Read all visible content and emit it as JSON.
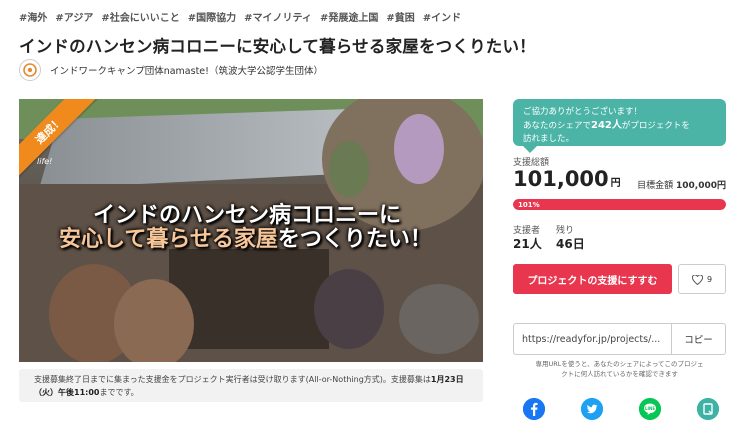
{
  "tags": [
    "#海外",
    "#アジア",
    "#社会にいいこと",
    "#国際協力",
    "#マイノリティ",
    "#発展途上国",
    "#貧困",
    "#インド"
  ],
  "project": {
    "title": "インドのハンセン病コロニーに安心して暮らせる家屋をつくりたい！",
    "org_name": "インドワークキャンプ団体namaste!（筑波大学公認学生団体）"
  },
  "hero": {
    "line1": "インドのハンセン病コロニーに",
    "line2_accent": "安心して暮らせる家屋",
    "line2_rest": "をつくりたい！",
    "ribbon": "達成！",
    "logo_text": "life!"
  },
  "notice": {
    "text_before": "支援募集終了日までに集まった支援金をプロジェクト実行者は受け取ります(All-or-Nothing方式)。支援募集は",
    "deadline": "1月23日（火）午後11:00",
    "text_after": "までです。"
  },
  "panel": {
    "balloon_line1": "ご協力ありがとうございます！",
    "balloon_pre": "あなたのシェアで",
    "balloon_count": "242人",
    "balloon_post": "がプロジェクトを",
    "balloon_line3": "訪れました。",
    "total_label": "支援総額",
    "total_amount": "101,000",
    "total_unit": "円",
    "goal_label": "目標金額",
    "goal_amount": "100,000円",
    "progress_text": "101%",
    "progress_fraction": 1.0,
    "supporters_label": "支援者",
    "supporters_value": "21人",
    "remaining_label": "残り",
    "remaining_value": "46日",
    "support_button": "プロジェクトの支援にすすむ",
    "like_count": "9",
    "share_url": "https://readyfor.jp/projects/...",
    "copy_button": "コピー",
    "share_note_line1": "専用URLを使うと、あなたのシェアによってこのプロジェ",
    "share_note_line2": "クトに何人訪れているかを確認できます"
  },
  "colors": {
    "accent_red": "#e8364f",
    "teal": "#4bb4a6",
    "ribbon_orange": "#f08a1c",
    "facebook": "#1877f2",
    "twitter": "#1da1f2",
    "line": "#06c755",
    "note": "#3eb3a5"
  },
  "icons": [
    "org-logo-icon",
    "heart-icon",
    "facebook-icon",
    "twitter-icon",
    "line-icon",
    "note-icon"
  ]
}
